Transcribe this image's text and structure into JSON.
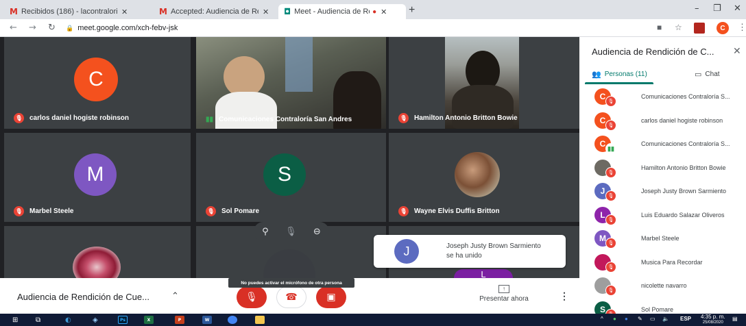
{
  "browser": {
    "tabs": [
      {
        "label": "Recibidos (186) - lacontraloriaco",
        "icon": "gmail-icon"
      },
      {
        "label": "Accepted: Audiencia de Rendició",
        "icon": "gmail-icon"
      },
      {
        "label": "Meet - Audiencia de Rendici",
        "icon": "meet-icon",
        "active": true
      }
    ],
    "new_tab": "+",
    "url": "meet.google.com/xch-febv-jsk",
    "profile_initial": "C"
  },
  "tiles": [
    {
      "name": "carlos daniel hogiste robinson",
      "initial": "C",
      "color": "#f4511e",
      "muted": true,
      "kind": "avatar"
    },
    {
      "name": "Comunicaciones Contraloría San Andres",
      "muted": false,
      "kind": "video"
    },
    {
      "name": "Hamilton Antonio Britton Bowie",
      "muted": true,
      "kind": "video"
    },
    {
      "name": "Marbel Steele",
      "initial": "M",
      "color": "#7e57c2",
      "muted": true,
      "kind": "avatar"
    },
    {
      "name": "Sol Pomare",
      "initial": "S",
      "color": "#0b5e45",
      "muted": true,
      "kind": "avatar"
    },
    {
      "name": "Wayne Elvis Duffis Britton",
      "muted": true,
      "kind": "photo"
    }
  ],
  "tooltip": "No puedes activar el micrófono de otra persona",
  "toast": {
    "initial": "J",
    "text": "Joseph Justy Brown Sarmiento se ha unido"
  },
  "peek_initial": "L",
  "callbar": {
    "meeting_title": "Audiencia de Rendición de Cue...",
    "present_label": "Presentar ahora"
  },
  "panel": {
    "title": "Audiencia de Rendición de C...",
    "people_tab": "Personas (11)",
    "chat_tab": "Chat",
    "people": [
      {
        "name": "Comunicaciones Contraloría S...",
        "initial": "C",
        "color": "#f4511e",
        "mic": "off"
      },
      {
        "name": "carlos daniel hogiste robinson",
        "initial": "C",
        "color": "#f4511e",
        "mic": "off"
      },
      {
        "name": "Comunicaciones Contraloría S...",
        "initial": "C",
        "color": "#f4511e",
        "mic": "on"
      },
      {
        "name": "Hamilton Antonio Britton Bowie",
        "initial": "",
        "color": "#6d6a63",
        "mic": "off"
      },
      {
        "name": "Joseph Justy Brown Sarmiento",
        "initial": "J",
        "color": "#5c6bc0",
        "mic": "off"
      },
      {
        "name": "Luis Eduardo Salazar Oliveros",
        "initial": "L",
        "color": "#8e24aa",
        "mic": "off"
      },
      {
        "name": "Marbel Steele",
        "initial": "M",
        "color": "#7e57c2",
        "mic": "off"
      },
      {
        "name": "Musica Para Recordar",
        "initial": "",
        "color": "#c2185b",
        "mic": "off"
      },
      {
        "name": "nicolette navarro",
        "initial": "",
        "color": "#9e9e9e",
        "mic": "off"
      },
      {
        "name": "Sol Pomare",
        "initial": "S",
        "color": "#0b5e45",
        "mic": "off"
      }
    ]
  },
  "taskbar": {
    "lang": "ESP",
    "time": "4:35 p. m.",
    "date": "25/08/2020"
  }
}
